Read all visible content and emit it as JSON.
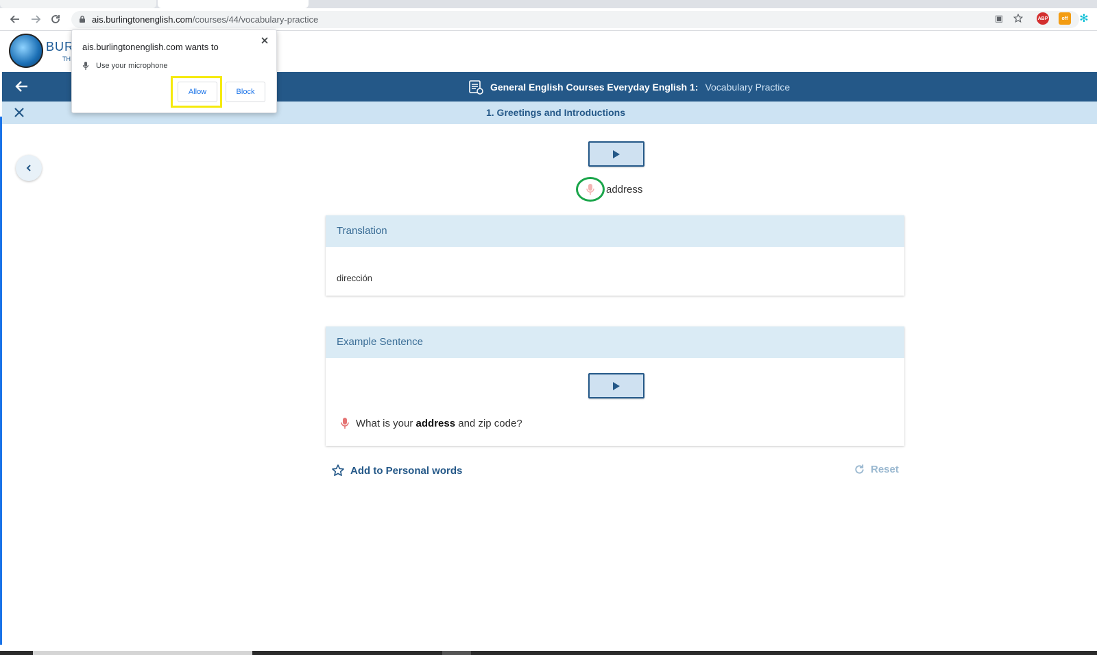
{
  "browser": {
    "url_host": "ais.burlingtonenglish.com",
    "url_path": "/courses/44/vocabulary-practice"
  },
  "site": {
    "logo_text": "BURL",
    "logo_subtext": "TH"
  },
  "permission_popup": {
    "title": "ais.burlingtonenglish.com wants to",
    "request": "Use your microphone",
    "allow_label": "Allow",
    "block_label": "Block"
  },
  "header": {
    "course": "General English Courses Everyday English 1:",
    "section": "Vocabulary Practice"
  },
  "lesson": {
    "title": "1. Greetings and Introductions"
  },
  "word": {
    "text": "address"
  },
  "translation": {
    "heading": "Translation",
    "text": "dirección"
  },
  "example": {
    "heading": "Example Sentence",
    "before": "What is your",
    "bold": "address",
    "after": "and zip code?"
  },
  "actions": {
    "add_personal": "Add to Personal words",
    "reset": "Reset"
  },
  "colors": {
    "primary": "#245888",
    "light_blue": "#cde3f3",
    "highlight_yellow": "#f5ea0d",
    "mic_circle_green": "#1aa54a"
  }
}
